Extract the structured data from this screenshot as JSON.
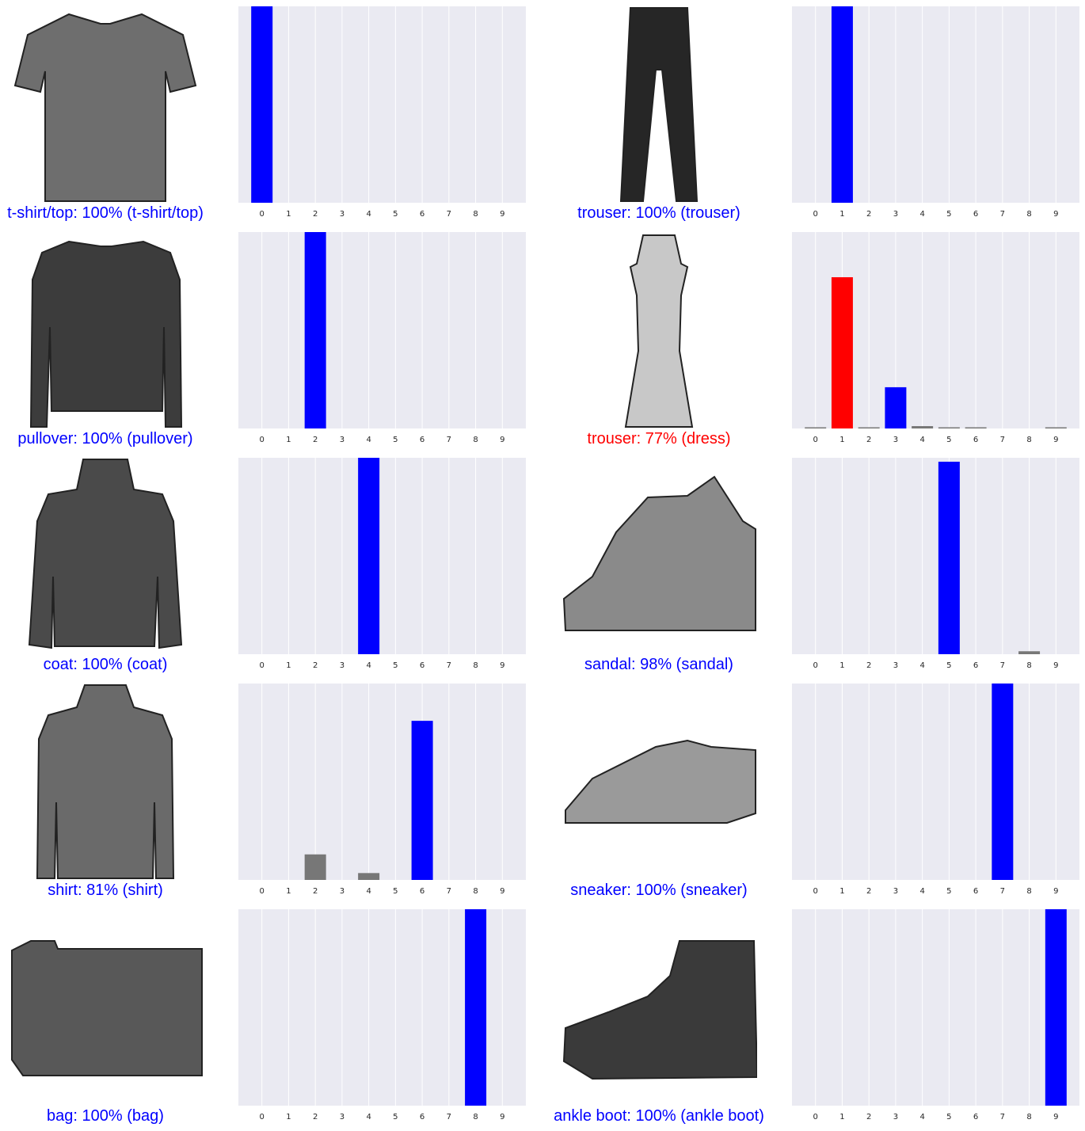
{
  "class_ticks": [
    "0",
    "1",
    "2",
    "3",
    "4",
    "5",
    "6",
    "7",
    "8",
    "9"
  ],
  "colors": {
    "correct": "#0000ff",
    "incorrect": "#ff0000",
    "other_bar": "#777777",
    "plot_background": "#eaeaf2",
    "gridline": "#ffffff"
  },
  "chart_data": [
    {
      "type": "bar",
      "predicted_label": "t-shirt/top",
      "confidence": "100%",
      "true_label": "t-shirt/top",
      "caption": "t-shirt/top: 100% (t-shirt/top)",
      "correct": true,
      "image": "t-shirt-icon",
      "categories": [
        "0",
        "1",
        "2",
        "3",
        "4",
        "5",
        "6",
        "7",
        "8",
        "9"
      ],
      "values": [
        1.0,
        0,
        0,
        0,
        0,
        0,
        0,
        0,
        0,
        0
      ],
      "predicted_index": 0,
      "true_index": 0,
      "ylim": [
        0,
        1
      ],
      "grid": "vertical",
      "yticks": "hidden"
    },
    {
      "type": "bar",
      "predicted_label": "trouser",
      "confidence": "100%",
      "true_label": "trouser",
      "caption": "trouser: 100% (trouser)",
      "correct": true,
      "image": "trouser-icon",
      "categories": [
        "0",
        "1",
        "2",
        "3",
        "4",
        "5",
        "6",
        "7",
        "8",
        "9"
      ],
      "values": [
        0,
        1.0,
        0,
        0,
        0,
        0,
        0,
        0,
        0,
        0
      ],
      "predicted_index": 1,
      "true_index": 1,
      "ylim": [
        0,
        1
      ],
      "grid": "vertical",
      "yticks": "hidden"
    },
    {
      "type": "bar",
      "predicted_label": "pullover",
      "confidence": "100%",
      "true_label": "pullover",
      "caption": "pullover: 100% (pullover)",
      "correct": true,
      "image": "pullover-icon",
      "categories": [
        "0",
        "1",
        "2",
        "3",
        "4",
        "5",
        "6",
        "7",
        "8",
        "9"
      ],
      "values": [
        0,
        0,
        1.0,
        0,
        0,
        0,
        0,
        0,
        0,
        0
      ],
      "predicted_index": 2,
      "true_index": 2,
      "ylim": [
        0,
        1
      ],
      "grid": "vertical",
      "yticks": "hidden"
    },
    {
      "type": "bar",
      "predicted_label": "trouser",
      "confidence": "77%",
      "true_label": "dress",
      "caption": "trouser: 77% (dress)",
      "correct": false,
      "image": "dress-icon",
      "categories": [
        "0",
        "1",
        "2",
        "3",
        "4",
        "5",
        "6",
        "7",
        "8",
        "9"
      ],
      "values": [
        0.003,
        0.77,
        0.003,
        0.21,
        0.012,
        0.002,
        0.002,
        0,
        0,
        0.002
      ],
      "predicted_index": 1,
      "true_index": 3,
      "ylim": [
        0,
        1
      ],
      "grid": "vertical",
      "yticks": "hidden"
    },
    {
      "type": "bar",
      "predicted_label": "coat",
      "confidence": "100%",
      "true_label": "coat",
      "caption": "coat: 100% (coat)",
      "correct": true,
      "image": "coat-icon",
      "categories": [
        "0",
        "1",
        "2",
        "3",
        "4",
        "5",
        "6",
        "7",
        "8",
        "9"
      ],
      "values": [
        0,
        0,
        0,
        0,
        1.0,
        0,
        0,
        0,
        0,
        0
      ],
      "predicted_index": 4,
      "true_index": 4,
      "ylim": [
        0,
        1
      ],
      "grid": "vertical",
      "yticks": "hidden"
    },
    {
      "type": "bar",
      "predicted_label": "sandal",
      "confidence": "98%",
      "true_label": "sandal",
      "caption": "sandal: 98% (sandal)",
      "correct": true,
      "image": "sandal-icon",
      "categories": [
        "0",
        "1",
        "2",
        "3",
        "4",
        "5",
        "6",
        "7",
        "8",
        "9"
      ],
      "values": [
        0,
        0,
        0,
        0,
        0,
        0.98,
        0,
        0,
        0.015,
        0
      ],
      "predicted_index": 5,
      "true_index": 5,
      "ylim": [
        0,
        1
      ],
      "grid": "vertical",
      "yticks": "hidden"
    },
    {
      "type": "bar",
      "predicted_label": "shirt",
      "confidence": "81%",
      "true_label": "shirt",
      "caption": "shirt: 81% (shirt)",
      "correct": true,
      "image": "shirt-icon",
      "categories": [
        "0",
        "1",
        "2",
        "3",
        "4",
        "5",
        "6",
        "7",
        "8",
        "9"
      ],
      "values": [
        0,
        0,
        0.13,
        0,
        0.035,
        0,
        0.81,
        0,
        0,
        0
      ],
      "predicted_index": 6,
      "true_index": 6,
      "ylim": [
        0,
        1
      ],
      "grid": "vertical",
      "yticks": "hidden"
    },
    {
      "type": "bar",
      "predicted_label": "sneaker",
      "confidence": "100%",
      "true_label": "sneaker",
      "caption": "sneaker: 100% (sneaker)",
      "correct": true,
      "image": "sneaker-icon",
      "categories": [
        "0",
        "1",
        "2",
        "3",
        "4",
        "5",
        "6",
        "7",
        "8",
        "9"
      ],
      "values": [
        0,
        0,
        0,
        0,
        0,
        0,
        0,
        1.0,
        0,
        0
      ],
      "predicted_index": 7,
      "true_index": 7,
      "ylim": [
        0,
        1
      ],
      "grid": "vertical",
      "yticks": "hidden"
    },
    {
      "type": "bar",
      "predicted_label": "bag",
      "confidence": "100%",
      "true_label": "bag",
      "caption": "bag: 100% (bag)",
      "correct": true,
      "image": "bag-icon",
      "categories": [
        "0",
        "1",
        "2",
        "3",
        "4",
        "5",
        "6",
        "7",
        "8",
        "9"
      ],
      "values": [
        0,
        0,
        0,
        0,
        0,
        0,
        0,
        0,
        1.0,
        0
      ],
      "predicted_index": 8,
      "true_index": 8,
      "ylim": [
        0,
        1
      ],
      "grid": "vertical",
      "yticks": "hidden"
    },
    {
      "type": "bar",
      "predicted_label": "ankle boot",
      "confidence": "100%",
      "true_label": "ankle boot",
      "caption": "ankle boot: 100% (ankle boot)",
      "correct": true,
      "image": "ankle-boot-icon",
      "categories": [
        "0",
        "1",
        "2",
        "3",
        "4",
        "5",
        "6",
        "7",
        "8",
        "9"
      ],
      "values": [
        0,
        0,
        0,
        0,
        0,
        0,
        0,
        0,
        0,
        1.0
      ],
      "predicted_index": 9,
      "true_index": 9,
      "ylim": [
        0,
        1
      ],
      "grid": "vertical",
      "yticks": "hidden"
    }
  ]
}
